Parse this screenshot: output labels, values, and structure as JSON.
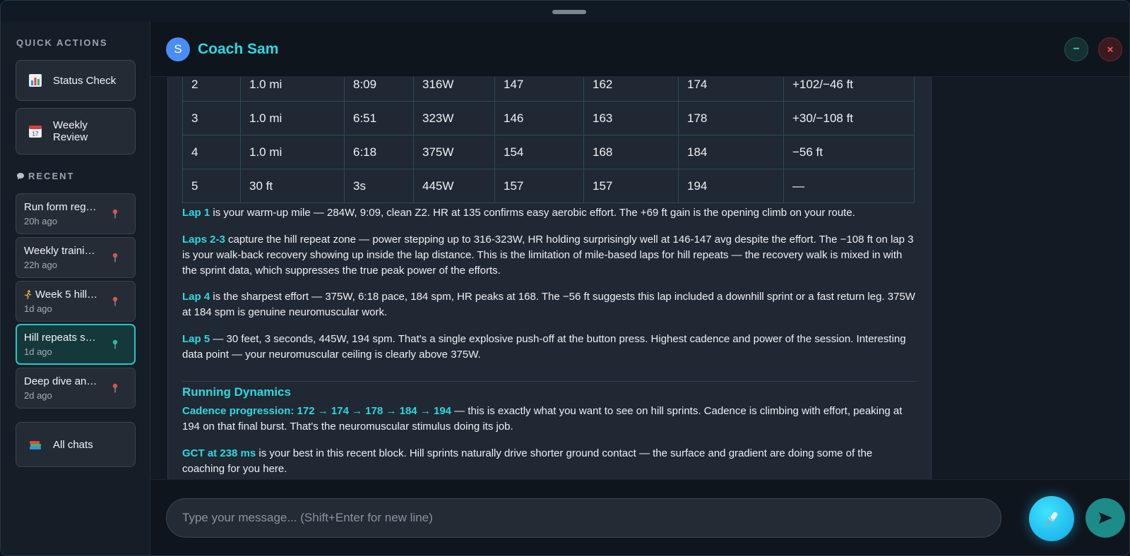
{
  "sidebar": {
    "quick_actions_title": "QUICK ACTIONS",
    "quick_actions": [
      {
        "label": "Status Check",
        "icon": "bar-chart-icon"
      },
      {
        "label": "Weekly Review",
        "icon": "calendar-icon"
      }
    ],
    "recent_title": "RECENT",
    "recent": [
      {
        "title": "Run form reg…",
        "time": "20h ago"
      },
      {
        "title": "Weekly traini…",
        "time": "22h ago"
      },
      {
        "title": "Week 5 hill…",
        "time": "1d ago"
      },
      {
        "title": "Hill repeats s…",
        "time": "1d ago",
        "active": true
      },
      {
        "title": "Deep dive an…",
        "time": "2d ago"
      }
    ],
    "all_chats_label": "All chats"
  },
  "header": {
    "avatar_letter": "S",
    "coach_name": "Coach Sam",
    "minimize_symbol": "−",
    "close_symbol": "×"
  },
  "laps_table": {
    "rows": [
      [
        "2",
        "1.0 mi",
        "8:09",
        "316W",
        "147",
        "162",
        "174",
        "+102/−46 ft"
      ],
      [
        "3",
        "1.0 mi",
        "6:51",
        "323W",
        "146",
        "163",
        "178",
        "+30/−108 ft"
      ],
      [
        "4",
        "1.0 mi",
        "6:18",
        "375W",
        "154",
        "168",
        "184",
        "−56 ft"
      ],
      [
        "5",
        "30 ft",
        "3s",
        "445W",
        "157",
        "157",
        "194",
        "—"
      ]
    ]
  },
  "analysis": {
    "lap1_label": "Lap 1",
    "lap1_text": " is your warm-up mile — 284W, 9:09, clean Z2. HR at 135 confirms easy aerobic effort. The +69 ft gain is the opening climb on your route.",
    "laps23_label": "Laps 2-3",
    "laps23_text": " capture the hill repeat zone — power stepping up to 316-323W, HR holding surprisingly well at 146-147 avg despite the effort. The −108 ft on lap 3 is your walk-back recovery showing up inside the lap distance. This is the limitation of mile-based laps for hill repeats — the recovery walk is mixed in with the sprint data, which suppresses the true peak power of the efforts.",
    "lap4_label": "Lap 4",
    "lap4_text": " is the sharpest effort — 375W, 6:18 pace, 184 spm, HR peaks at 168. The −56 ft suggests this lap included a downhill sprint or a fast return leg. 375W at 184 spm is genuine neuromuscular work.",
    "lap5_label": "Lap 5",
    "lap5_text": " — 30 feet, 3 seconds, 445W, 194 spm. That's a single explosive push-off at the button press. Highest cadence and power of the session. Interesting data point — your neuromuscular ceiling is clearly above 375W.",
    "dynamics_heading": "Running Dynamics",
    "cadence_label": "Cadence progression: 172 → 174 → 178 → 184 → 194",
    "cadence_text": " — this is exactly what you want to see on hill sprints. Cadence is climbing with effort, peaking at 194 on that final burst. That's the neuromuscular stimulus doing its job.",
    "gct_label": "GCT at 238 ms",
    "gct_text": " is your best in this recent block. Hill sprints naturally drive shorter ground contact — the surface and gradient are doing some of the coaching for you here."
  },
  "composer": {
    "placeholder": "Type your message... (Shift+Enter for new line)"
  },
  "colors": {
    "accent": "#2dd8e0",
    "active_border": "#24c9c7",
    "avatar": "#4a8df5",
    "close": "#ff5a66"
  }
}
